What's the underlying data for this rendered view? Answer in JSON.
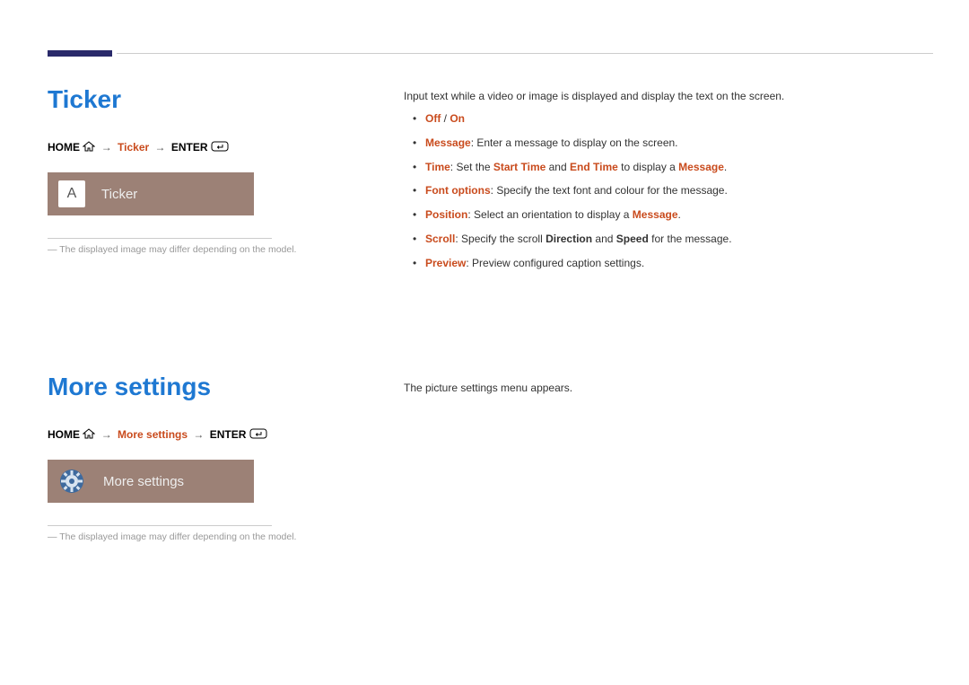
{
  "section1": {
    "title": "Ticker",
    "breadcrumb": {
      "home": "HOME",
      "mid": "Ticker",
      "enter": "ENTER"
    },
    "tile": {
      "icon_letter": "A",
      "label": "Ticker"
    },
    "note": "The displayed image may differ depending on the model.",
    "intro": "Input text while a video or image is displayed and display the text on the screen.",
    "bullets": {
      "b1": {
        "off": "Off",
        "slash": " / ",
        "on": "On"
      },
      "b2": {
        "lead": "Message",
        "rest": ": Enter a message to display on the screen."
      },
      "b3": {
        "p1": "Time",
        "p2": ": Set the ",
        "p3": "Start Time",
        "p4": " and ",
        "p5": "End Time",
        "p6": " to display a ",
        "p7": "Message",
        "p8": "."
      },
      "b4": {
        "lead": "Font options",
        "rest": ": Specify the text font and colour for the message."
      },
      "b5": {
        "p1": "Position",
        "p2": ": Select an orientation to display a ",
        "p3": "Message",
        "p4": "."
      },
      "b6": {
        "p1": "Scroll",
        "p2": ": Specify the scroll ",
        "p3": "Direction",
        "p4": " and ",
        "p5": "Speed",
        "p6": " for the message."
      },
      "b7": {
        "lead": "Preview",
        "rest": ": Preview configured caption settings."
      }
    }
  },
  "section2": {
    "title": "More settings",
    "breadcrumb": {
      "home": "HOME",
      "mid": "More settings",
      "enter": "ENTER"
    },
    "tile": {
      "label": "More settings"
    },
    "note": "The displayed image may differ depending on the model.",
    "intro": "The picture settings menu appears."
  }
}
